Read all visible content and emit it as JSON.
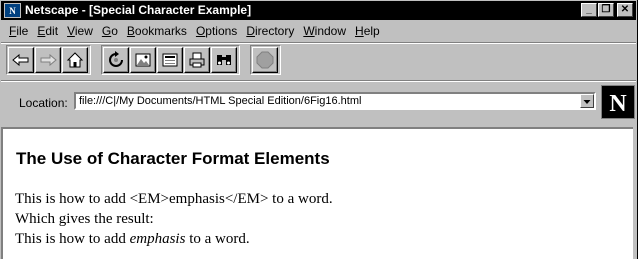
{
  "window": {
    "title": "Netscape - [Special Character Example]",
    "minimize_glyph": "_",
    "restore_glyph": "❐",
    "close_glyph": "✕"
  },
  "menu": [
    {
      "underline": "F",
      "rest": "ile"
    },
    {
      "underline": "E",
      "rest": "dit"
    },
    {
      "underline": "V",
      "rest": "iew"
    },
    {
      "underline": "G",
      "rest": "o"
    },
    {
      "underline": "B",
      "rest": "ookmarks"
    },
    {
      "underline": "O",
      "rest": "ptions"
    },
    {
      "underline": "D",
      "rest": "irectory"
    },
    {
      "underline": "W",
      "rest": "indow"
    },
    {
      "underline": "H",
      "rest": "elp"
    }
  ],
  "toolbar": {
    "buttons": [
      "back-icon",
      "forward-icon",
      "home-icon",
      "reload-icon",
      "images-icon",
      "open-icon",
      "print-icon",
      "find-icon",
      "stop-icon"
    ]
  },
  "location": {
    "label": "Location:",
    "url": "file:///C|/My Documents/HTML Special Edition/6Fig16.html"
  },
  "content": {
    "heading": "The Use of Character Format Elements",
    "line1": "This is how to add <EM>emphasis</EM> to a word.",
    "line2": "Which gives the result:",
    "line3_before": "This is how to add ",
    "line3_em": "emphasis",
    "line3_after": " to a word."
  },
  "colors": {
    "chrome": "#c0c0c0",
    "titlebar": "#000000",
    "content_bg": "#ffffff"
  }
}
